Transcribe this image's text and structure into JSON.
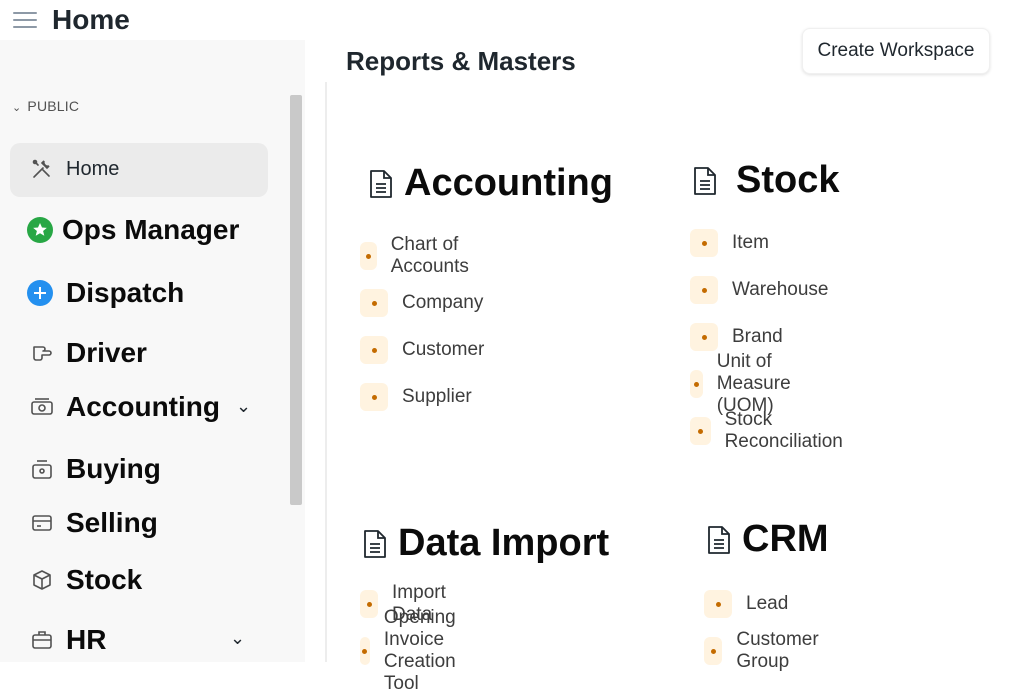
{
  "header": {
    "title": "Home",
    "menu_icon": "hamburger-icon"
  },
  "sidebar": {
    "section": "PUBLIC",
    "items": [
      {
        "label": "Home",
        "icon": "tools-icon",
        "active": true
      },
      {
        "label": "Ops Manager",
        "icon": "star-badge-icon",
        "color": "#28a745"
      },
      {
        "label": "Dispatch",
        "icon": "plus-circle-icon",
        "color": "#2490ef"
      },
      {
        "label": "Driver",
        "icon": "hand-pointer-icon"
      },
      {
        "label": "Accounting",
        "icon": "money-icon",
        "caret": true
      },
      {
        "label": "Buying",
        "icon": "bag-icon"
      },
      {
        "label": "Selling",
        "icon": "card-icon"
      },
      {
        "label": "Stock",
        "icon": "box-icon"
      },
      {
        "label": "HR",
        "icon": "briefcase-icon",
        "caret": true
      }
    ]
  },
  "main": {
    "heading": "Reports & Masters",
    "create_button": "Create Workspace",
    "cards": [
      {
        "title": "Accounting",
        "links": [
          "Chart of Accounts",
          "Company",
          "Customer",
          "Supplier"
        ]
      },
      {
        "title": "Stock",
        "links": [
          "Item",
          "Warehouse",
          "Brand",
          "Unit of Measure (UOM)",
          "Stock Reconciliation"
        ]
      },
      {
        "title": "Data Import",
        "links": [
          "Import Data",
          "Opening Invoice Creation Tool"
        ]
      },
      {
        "title": "CRM",
        "links": [
          "Lead",
          "Customer Group"
        ]
      }
    ]
  },
  "colors": {
    "accent_dot": "#c46b00",
    "dot_bg": "#fff3e0",
    "sidebar_bg": "#f8f8f8"
  }
}
